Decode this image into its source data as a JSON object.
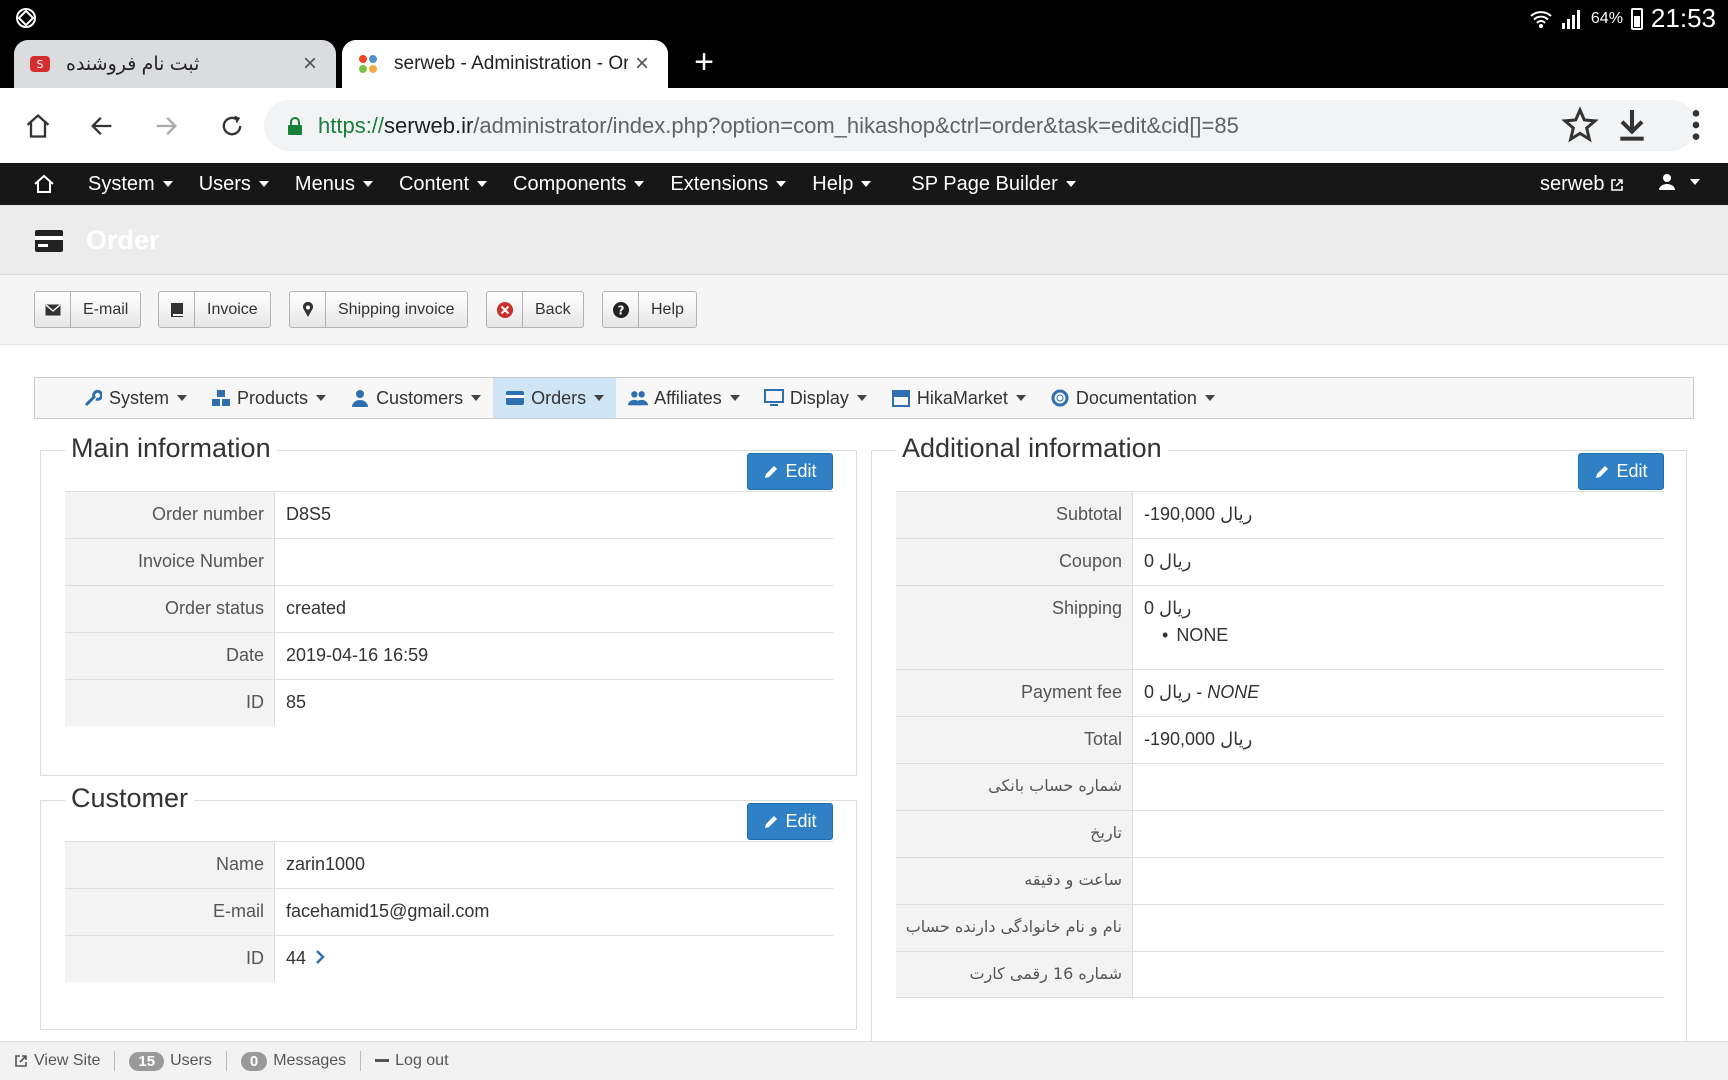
{
  "status_bar": {
    "battery": "64%",
    "time": "21:53"
  },
  "tabs": [
    {
      "title": "ثبت نام فروشنده",
      "active": false
    },
    {
      "title": "serweb - Administration - Order",
      "active": true
    }
  ],
  "address": {
    "scheme": "https://",
    "host": "serweb.ir",
    "path": "/administrator/index.php?option=com_hikashop&ctrl=order&task=edit&cid[]=85"
  },
  "joomla_nav": {
    "items": [
      "System",
      "Users",
      "Menus",
      "Content",
      "Components",
      "Extensions",
      "Help",
      "SP Page Builder"
    ],
    "user": "serweb"
  },
  "page_title": "Order",
  "toolbar": {
    "email": "E-mail",
    "invoice": "Invoice",
    "shipping_invoice": "Shipping invoice",
    "back": "Back",
    "help": "Help"
  },
  "hika_menu": [
    "System",
    "Products",
    "Customers",
    "Orders",
    "Affiliates",
    "Display",
    "HikaMarket",
    "Documentation"
  ],
  "main_info": {
    "legend": "Main information",
    "edit": "Edit",
    "rows": [
      {
        "label": "Order number",
        "value": "D8S5"
      },
      {
        "label": "Invoice Number",
        "value": ""
      },
      {
        "label": "Order status",
        "value": "created"
      },
      {
        "label": "Date",
        "value": "2019-04-16 16:59"
      },
      {
        "label": "ID",
        "value": "85"
      }
    ]
  },
  "customer": {
    "legend": "Customer",
    "edit": "Edit",
    "rows": [
      {
        "label": "Name",
        "value": "zarin1000"
      },
      {
        "label": "E-mail",
        "value": "facehamid15@gmail.com"
      },
      {
        "label": "ID",
        "value": "44"
      }
    ]
  },
  "additional": {
    "legend": "Additional information",
    "edit": "Edit",
    "subtotal_label": "Subtotal",
    "subtotal": "-190,000 ریال",
    "coupon_label": "Coupon",
    "coupon": "0 ریال",
    "shipping_label": "Shipping",
    "shipping": "0 ریال",
    "shipping_method": "NONE",
    "payment_fee_label": "Payment fee",
    "payment_fee": "0 ریال - ",
    "payment_method": "NONE",
    "total_label": "Total",
    "total": "-190,000 ریال",
    "custom_fields": [
      "شماره حساب بانکی",
      "تاریخ",
      "ساعت و دقیقه",
      "نام و نام خانوادگی دارنده حساب",
      "شماره 16 رقمی کارت"
    ]
  },
  "footer": {
    "view_site": "View Site",
    "users_count": "15",
    "users": "Users",
    "messages_count": "0",
    "messages": "Messages",
    "logout": "Log out"
  }
}
